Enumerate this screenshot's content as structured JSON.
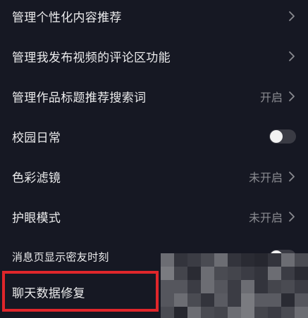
{
  "settings": {
    "items": [
      {
        "label": "管理个性化内容推荐",
        "status": "",
        "control": "chevron"
      },
      {
        "label": "管理我发布视频的评论区功能",
        "status": "",
        "control": "chevron"
      },
      {
        "label": "管理作品标题推荐搜索词",
        "status": "开启",
        "control": "chevron"
      },
      {
        "label": "校园日常",
        "status": "",
        "control": "toggle",
        "toggle_on": false
      },
      {
        "label": "色彩滤镜",
        "status": "未开启",
        "control": "chevron"
      },
      {
        "label": "护眼模式",
        "status": "未开启",
        "control": "chevron"
      },
      {
        "label": "消息页显示密友时刻",
        "status": "",
        "control": "toggle",
        "toggle_on": false
      },
      {
        "label": "聊天数据修复",
        "status": "",
        "control": "none"
      }
    ]
  },
  "colors": {
    "background": "#161823",
    "text": "#ebebec",
    "secondary_text": "#8a8b91",
    "highlight": "#e0262b",
    "toggle_off": "#3a3b44"
  },
  "icons": {
    "chevron": "chevron-right-icon"
  }
}
